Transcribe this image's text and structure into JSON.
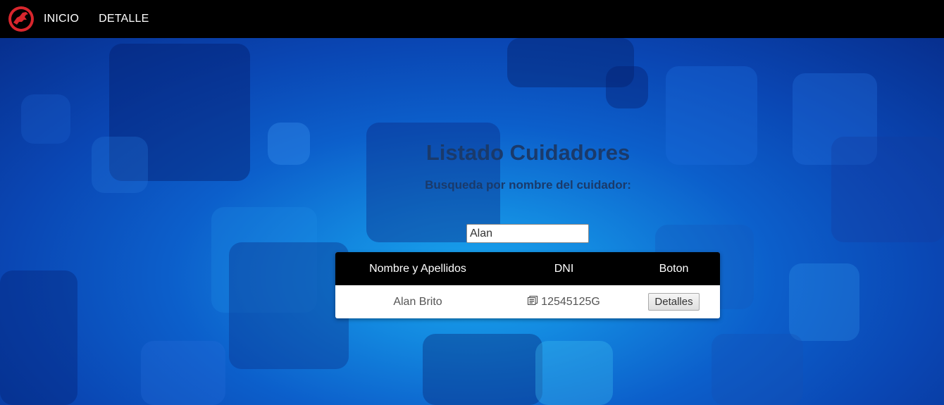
{
  "nav": {
    "logo_icon": "dinosaur-logo-icon",
    "items": [
      {
        "label": "INICIO"
      },
      {
        "label": "DETALLE"
      }
    ]
  },
  "page": {
    "title": "Listado Cuidadores",
    "subtitle": "Busqueda por nombre del cuidador:"
  },
  "search": {
    "value": "Alan",
    "placeholder": ""
  },
  "table": {
    "headers": [
      "Nombre y Apellidos",
      "DNI",
      "Boton"
    ],
    "rows": [
      {
        "name": "Alan Brito",
        "dni_icon": "id-card-icon",
        "dni": "12545125G",
        "button_label": "Detalles"
      }
    ]
  },
  "colors": {
    "navbar": "#000000",
    "logo": "#d8262d",
    "title": "#1a3a6b",
    "table_header": "#000000"
  }
}
